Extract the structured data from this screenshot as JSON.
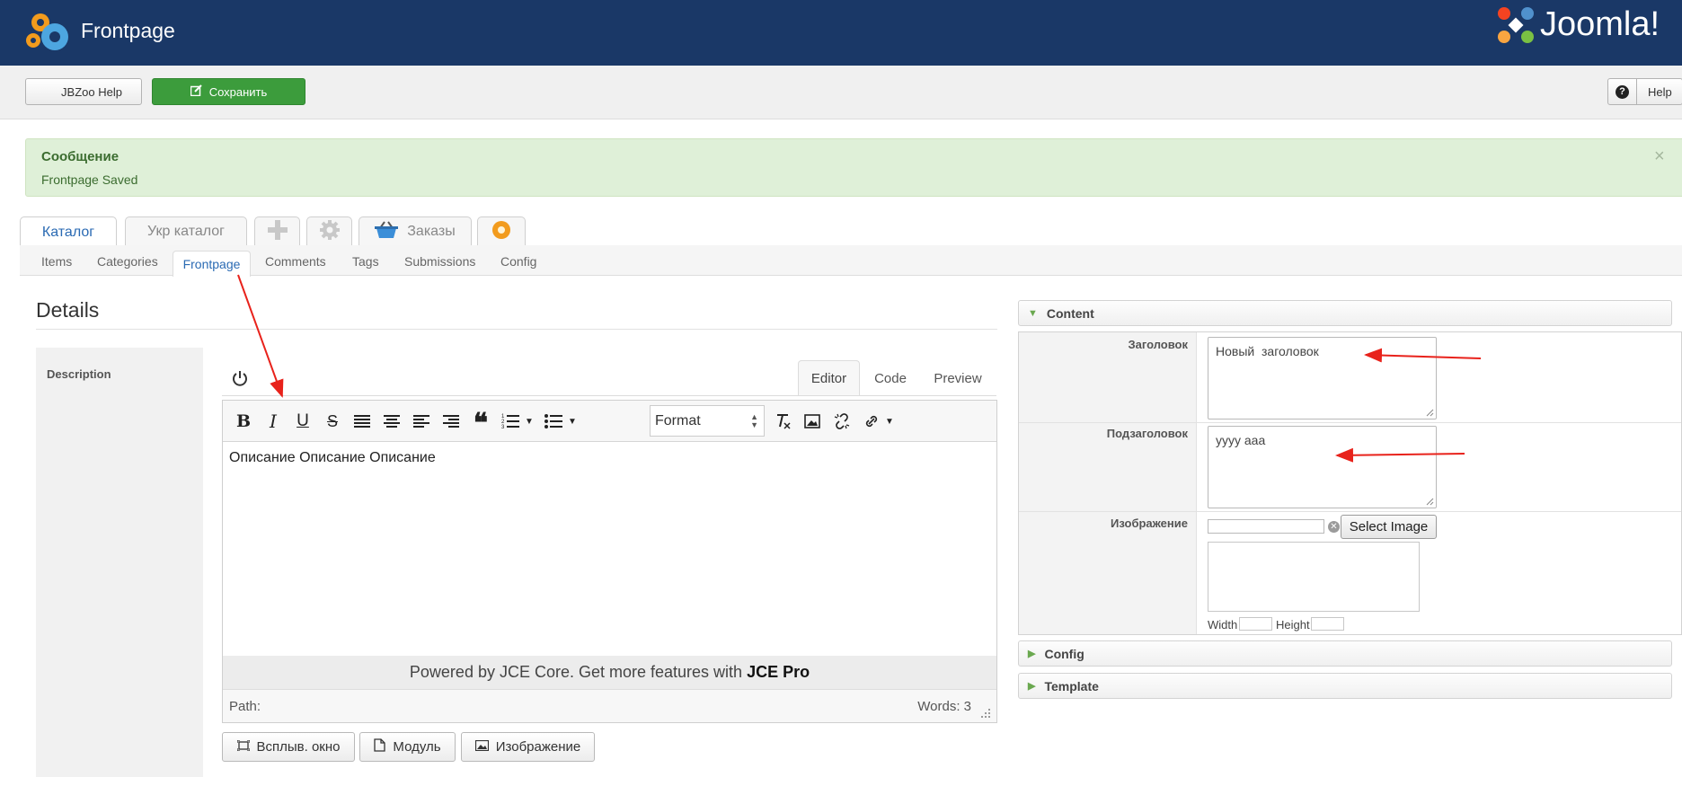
{
  "header": {
    "title": "Frontpage",
    "brand": "Joomla!",
    "brand_name": "Joomla!",
    "colors": {
      "background": "#1a3867",
      "text": "#ffffff"
    }
  },
  "toolbar": {
    "jbzoo_help_label": "JBZoo Help",
    "save_label": "Сохранить",
    "help_label": "Help",
    "save_color": "#3c9c3c"
  },
  "message": {
    "title": "Сообщение",
    "text": "Frontpage Saved",
    "close": "×",
    "background": "#dff0d8"
  },
  "main_tabs": [
    {
      "label": "Каталог",
      "active": true
    },
    {
      "label": "Укр каталог",
      "active": false
    },
    {
      "label": "",
      "icon": "plus-icon"
    },
    {
      "label": "",
      "icon": "gear-icon"
    },
    {
      "label": "Заказы",
      "icon": "basket-icon"
    },
    {
      "label": "",
      "icon": "gear-badge-icon"
    }
  ],
  "sub_tabs": [
    {
      "label": "Items"
    },
    {
      "label": "Categories"
    },
    {
      "label": "Frontpage",
      "active": true
    },
    {
      "label": "Comments"
    },
    {
      "label": "Tags"
    },
    {
      "label": "Submissions"
    },
    {
      "label": "Config"
    }
  ],
  "details": {
    "title": "Details",
    "description_label": "Description"
  },
  "editor": {
    "tabs": [
      {
        "label": "Editor",
        "active": true
      },
      {
        "label": "Code"
      },
      {
        "label": "Preview"
      }
    ],
    "toolbar": {
      "bold": "B",
      "italic": "I",
      "underline": "U",
      "strike": "S",
      "quote": "❝",
      "format_label": "Format"
    },
    "content": "Описание Описание Описание",
    "powered_text": "Powered by JCE Core. Get more features with",
    "powered_bold": "JCE Pro",
    "path_label": "Path:",
    "words_label": "Words: 3"
  },
  "editor_buttons": [
    {
      "label": "Всплыв. окно",
      "icon": "popup-icon"
    },
    {
      "label": "Модуль",
      "icon": "module-icon"
    },
    {
      "label": "Изображение",
      "icon": "image-icon"
    }
  ],
  "right_panel": {
    "sections": [
      {
        "label": "Content",
        "expanded": true
      },
      {
        "label": "Config",
        "expanded": false
      },
      {
        "label": "Template",
        "expanded": false
      }
    ],
    "fields": {
      "title_label": "Заголовок",
      "title_value": "Новый  заголовок",
      "subtitle_label": "Подзаголовок",
      "subtitle_value": "yyyy aaa",
      "image_label": "Изображение",
      "select_image_label": "Select Image",
      "width_label": "Width",
      "height_label": "Height"
    }
  }
}
